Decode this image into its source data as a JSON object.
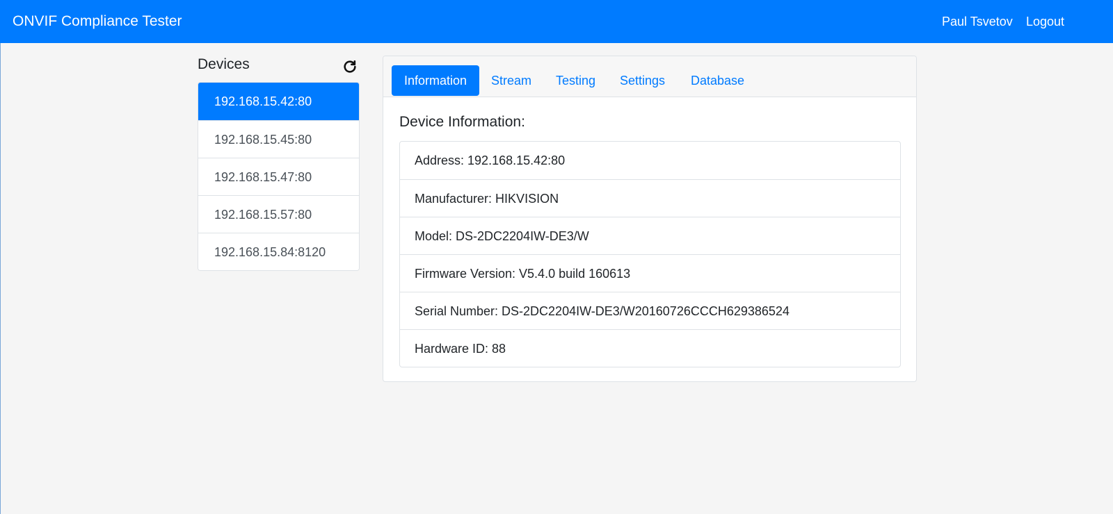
{
  "navbar": {
    "brand": "ONVIF Compliance Tester",
    "user": "Paul Tsvetov",
    "logout": "Logout"
  },
  "sidebar": {
    "title": "Devices",
    "refresh_icon": "refresh-icon",
    "devices": [
      {
        "label": "192.168.15.42:80",
        "active": true
      },
      {
        "label": "192.168.15.45:80",
        "active": false
      },
      {
        "label": "192.168.15.47:80",
        "active": false
      },
      {
        "label": "192.168.15.57:80",
        "active": false
      },
      {
        "label": "192.168.15.84:8120",
        "active": false
      }
    ]
  },
  "tabs": [
    {
      "label": "Information",
      "active": true
    },
    {
      "label": "Stream",
      "active": false
    },
    {
      "label": "Testing",
      "active": false
    },
    {
      "label": "Settings",
      "active": false
    },
    {
      "label": "Database",
      "active": false
    }
  ],
  "main": {
    "section_title": "Device Information:",
    "info": [
      "Address: 192.168.15.42:80",
      "Manufacturer: HIKVISION",
      "Model: DS-2DC2204IW-DE3/W",
      "Firmware Version: V5.4.0 build 160613",
      "Serial Number: DS-2DC2204IW-DE3/W20160726CCCH629386524",
      "Hardware ID: 88"
    ]
  },
  "colors": {
    "primary": "#007bff",
    "background": "#f5f5f5",
    "border": "#dee2e6"
  }
}
